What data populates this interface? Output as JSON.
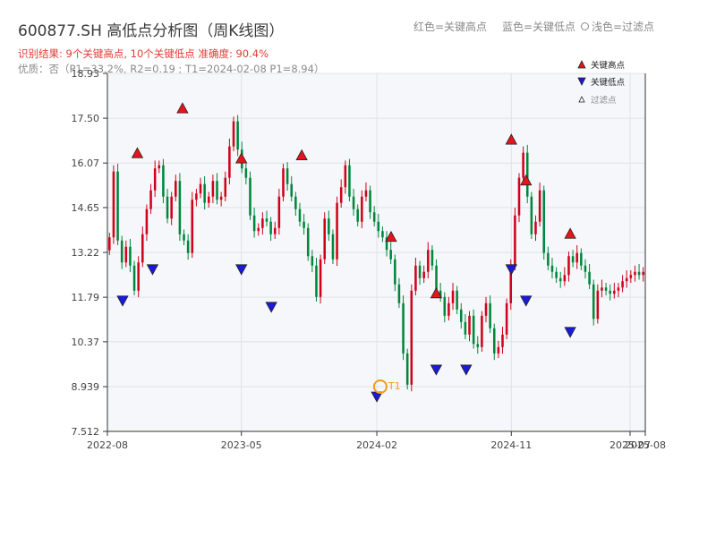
{
  "header": {
    "title": "600877.SH 高低点分析图（周K线图）",
    "result": "识别结果: 9个关键高点, 10个关键低点   准确度: 90.4%",
    "quality": "优质：否（P1=33.2%, R2=0.19 ; T1=2024-02-08 P1=8.94）",
    "color_legend": [
      "红色=关键高点",
      "蓝色=关键低点",
      "浅色=过滤点"
    ]
  },
  "colors": {
    "up": "#d0021b",
    "down": "#00873c",
    "high_marker": "#e8141c",
    "low_marker": "#1a1ad8",
    "t1": "#f39c12",
    "plot_bg": "#f5f7fa",
    "grid": "#dde3ea"
  },
  "chart_data": {
    "type": "candlestick",
    "ylim": [
      7.512,
      18.93
    ],
    "y_ticks": [
      "18.93",
      "17.50",
      "16.07",
      "14.65",
      "13.22",
      "11.79",
      "10.37",
      "8.939",
      "7.512"
    ],
    "x_ticks": [
      "2022-08",
      "2023-05",
      "2024-02",
      "2024-11",
      "2025-07",
      "2025-08"
    ],
    "grid": true,
    "legend_position": "top-right",
    "legend": [
      "关键高点",
      "关键低点",
      "过滤点"
    ],
    "closes": [
      13.7,
      15.8,
      13.6,
      12.9,
      13.4,
      12.8,
      12.0,
      12.9,
      13.8,
      14.6,
      15.2,
      15.9,
      16.0,
      15.0,
      14.3,
      15.0,
      15.5,
      13.8,
      13.6,
      13.2,
      14.9,
      15.1,
      15.4,
      14.8,
      15.0,
      15.5,
      14.9,
      15.0,
      15.6,
      16.6,
      17.4,
      16.5,
      15.9,
      15.6,
      14.4,
      13.9,
      14.0,
      14.3,
      14.2,
      13.8,
      14.0,
      15.0,
      15.9,
      15.4,
      15.0,
      14.6,
      14.2,
      14.0,
      13.1,
      12.8,
      11.8,
      13.0,
      14.3,
      13.8,
      13.0,
      14.8,
      15.3,
      16.0,
      15.0,
      14.6,
      14.2,
      15.0,
      15.2,
      14.5,
      14.2,
      13.9,
      13.7,
      13.3,
      13.0,
      12.2,
      11.6,
      10.0,
      9.0,
      12.0,
      12.8,
      12.4,
      12.6,
      13.3,
      12.8,
      12.0,
      11.8,
      11.2,
      11.6,
      12.0,
      11.4,
      11.0,
      10.6,
      11.2,
      10.3,
      10.2,
      11.2,
      11.6,
      10.8,
      10.0,
      10.2,
      10.6,
      11.6,
      12.8,
      14.4,
      15.6,
      16.4,
      15.0,
      13.8,
      14.2,
      15.2,
      13.2,
      12.8,
      12.6,
      12.4,
      12.3,
      12.5,
      13.1,
      12.9,
      13.2,
      12.8,
      12.6,
      12.2,
      11.1,
      12.0,
      12.1,
      12.0,
      11.9,
      12.0,
      12.1,
      12.3,
      12.4,
      12.5,
      12.6,
      12.5,
      12.6
    ],
    "key_highs": [
      {
        "date": "2022-10",
        "price": 16.07
      },
      {
        "date": "2023-01",
        "price": 17.5
      },
      {
        "date": "2023-05",
        "price": 15.9
      },
      {
        "date": "2023-09",
        "price": 16.0
      },
      {
        "date": "2024-03",
        "price": 13.4
      },
      {
        "date": "2024-06",
        "price": 11.6
      },
      {
        "date": "2024-11",
        "price": 16.5
      },
      {
        "date": "2024-12",
        "price": 15.2
      },
      {
        "date": "2025-03",
        "price": 13.5
      }
    ],
    "key_lows": [
      {
        "date": "2022-09",
        "price": 12.0
      },
      {
        "date": "2022-11",
        "price": 13.0
      },
      {
        "date": "2023-05",
        "price": 13.0
      },
      {
        "date": "2023-07",
        "price": 11.8
      },
      {
        "date": "2024-02",
        "price": 8.94
      },
      {
        "date": "2024-06",
        "price": 9.8
      },
      {
        "date": "2024-08",
        "price": 9.8
      },
      {
        "date": "2024-11",
        "price": 13.0
      },
      {
        "date": "2024-12",
        "price": 12.0
      },
      {
        "date": "2025-03",
        "price": 11.0
      }
    ],
    "t1": {
      "label": "T1",
      "date": "2024-02-08",
      "price": 8.94
    }
  }
}
